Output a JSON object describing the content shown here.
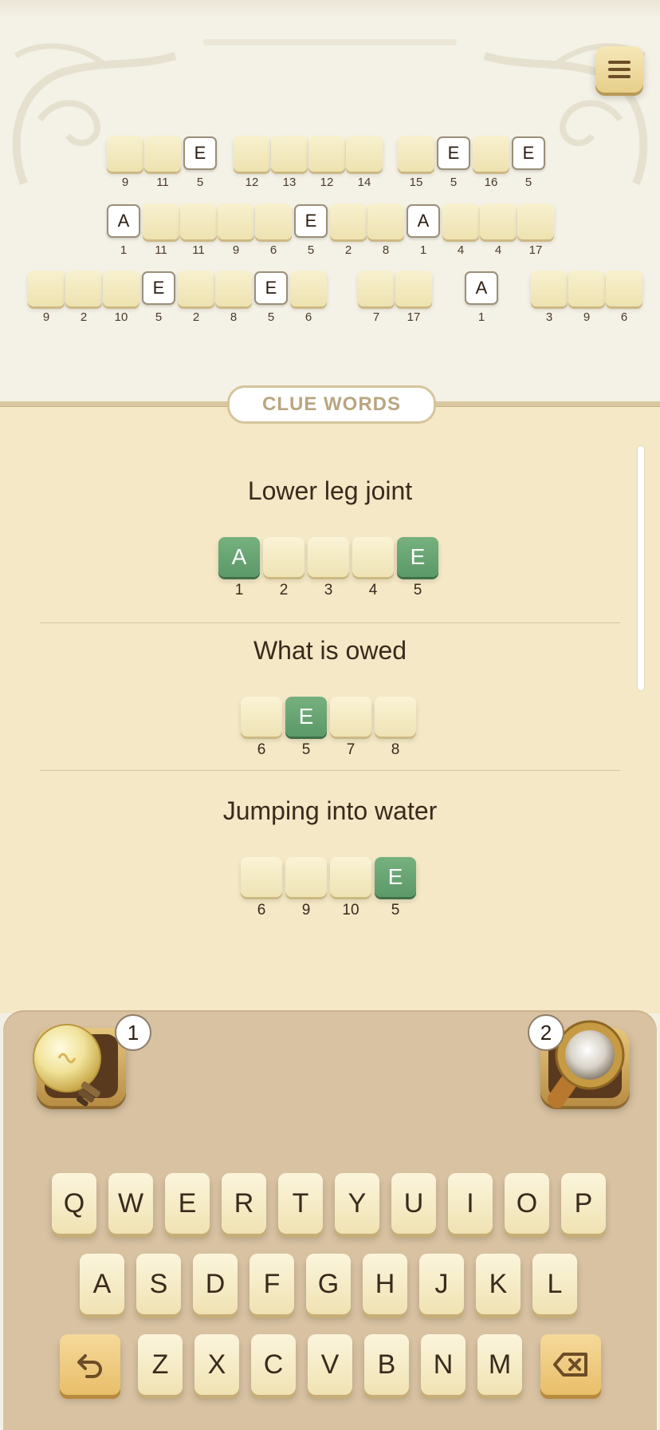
{
  "phrase_rows": [
    [
      {
        "n": "9",
        "c": ""
      },
      {
        "n": "11",
        "c": ""
      },
      {
        "n": "5",
        "c": "E"
      },
      null,
      {
        "n": "12",
        "c": ""
      },
      {
        "n": "13",
        "c": ""
      },
      {
        "n": "12",
        "c": ""
      },
      {
        "n": "14",
        "c": ""
      },
      null,
      {
        "n": "15",
        "c": ""
      },
      {
        "n": "5",
        "c": "E"
      },
      {
        "n": "16",
        "c": ""
      },
      {
        "n": "5",
        "c": "E"
      }
    ],
    [
      {
        "n": "1",
        "c": "A"
      },
      {
        "n": "11",
        "c": ""
      },
      {
        "n": "11",
        "c": ""
      },
      {
        "n": "9",
        "c": ""
      },
      {
        "n": "6",
        "c": ""
      },
      {
        "n": "5",
        "c": "E"
      },
      {
        "n": "2",
        "c": ""
      },
      {
        "n": "8",
        "c": ""
      },
      {
        "n": "1",
        "c": "A"
      },
      {
        "n": "4",
        "c": ""
      },
      {
        "n": "4",
        "c": ""
      },
      {
        "n": "17",
        "c": ""
      }
    ],
    [
      {
        "n": "9",
        "c": ""
      },
      {
        "n": "2",
        "c": ""
      },
      {
        "n": "10",
        "c": ""
      },
      {
        "n": "5",
        "c": "E"
      },
      {
        "n": "2",
        "c": ""
      },
      {
        "n": "8",
        "c": ""
      },
      {
        "n": "5",
        "c": "E"
      },
      {
        "n": "6",
        "c": ""
      },
      null,
      {
        "n": "7",
        "c": ""
      },
      {
        "n": "17",
        "c": ""
      },
      null,
      {
        "n": "1",
        "c": "A"
      },
      null,
      {
        "n": "3",
        "c": ""
      },
      {
        "n": "9",
        "c": ""
      },
      {
        "n": "6",
        "c": ""
      }
    ]
  ],
  "clue_header": "CLUE WORDS",
  "clues": [
    {
      "text": "Lower leg joint",
      "cells": [
        {
          "n": "1",
          "c": "A"
        },
        {
          "n": "2",
          "c": ""
        },
        {
          "n": "3",
          "c": ""
        },
        {
          "n": "4",
          "c": ""
        },
        {
          "n": "5",
          "c": "E"
        }
      ]
    },
    {
      "text": "What is owed",
      "cells": [
        {
          "n": "6",
          "c": ""
        },
        {
          "n": "5",
          "c": "E"
        },
        {
          "n": "7",
          "c": ""
        },
        {
          "n": "8",
          "c": ""
        }
      ]
    },
    {
      "text": "Jumping into water",
      "cells": [
        {
          "n": "6",
          "c": ""
        },
        {
          "n": "9",
          "c": ""
        },
        {
          "n": "10",
          "c": ""
        },
        {
          "n": "5",
          "c": "E"
        }
      ]
    }
  ],
  "powerups": {
    "hint_count": "1",
    "reveal_count": "2"
  },
  "keyboard": {
    "row1": [
      "Q",
      "W",
      "E",
      "R",
      "T",
      "Y",
      "U",
      "I",
      "O",
      "P"
    ],
    "row2": [
      "A",
      "S",
      "D",
      "F",
      "G",
      "H",
      "J",
      "K",
      "L"
    ],
    "row3": [
      "Z",
      "X",
      "C",
      "V",
      "B",
      "N",
      "M"
    ],
    "undo_icon": "undo-icon",
    "backspace_icon": "backspace-icon"
  },
  "colors": {
    "green_tile": "#6aa674",
    "accent_gold": "#e8be6a"
  }
}
